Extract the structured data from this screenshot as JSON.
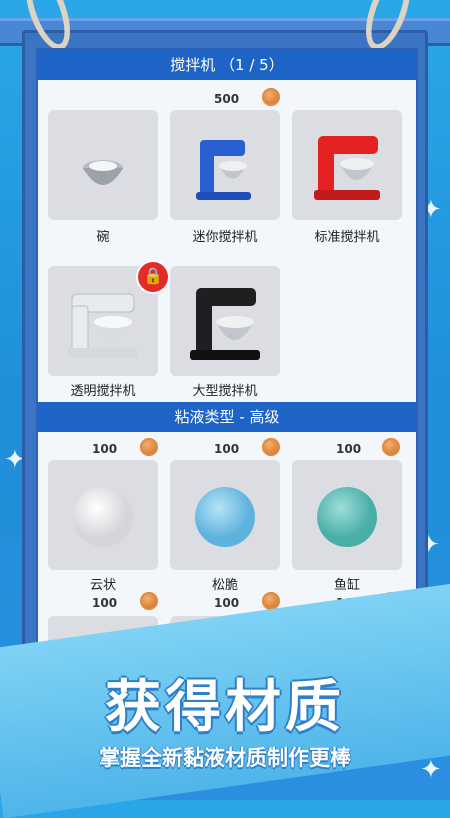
{
  "mixer_section": {
    "title": "搅拌机  （1 / 5）",
    "cost": "500",
    "items": [
      {
        "label": "碗"
      },
      {
        "label": "迷你搅拌机"
      },
      {
        "label": "标准搅拌机"
      },
      {
        "label": "透明搅拌机"
      },
      {
        "label": "大型搅拌机"
      }
    ]
  },
  "slime_section": {
    "title": "粘液类型 - 高级",
    "items": [
      {
        "label": "云状",
        "cost": "100",
        "color": "#ffffff"
      },
      {
        "label": "松脆",
        "cost": "100",
        "color": "#8dd0ef"
      },
      {
        "label": "鱼缸",
        "cost": "100",
        "color": "#69c6c0"
      }
    ],
    "next_costs": [
      "100",
      "100",
      "100"
    ]
  },
  "banner": {
    "title": "获得材质",
    "subtitle": "掌握全新黏液材质制作更棒"
  },
  "colors": {
    "accent_blue": "#1e63c6",
    "coin_orange": "#d47a2e",
    "lock_red": "#e52a2a"
  }
}
